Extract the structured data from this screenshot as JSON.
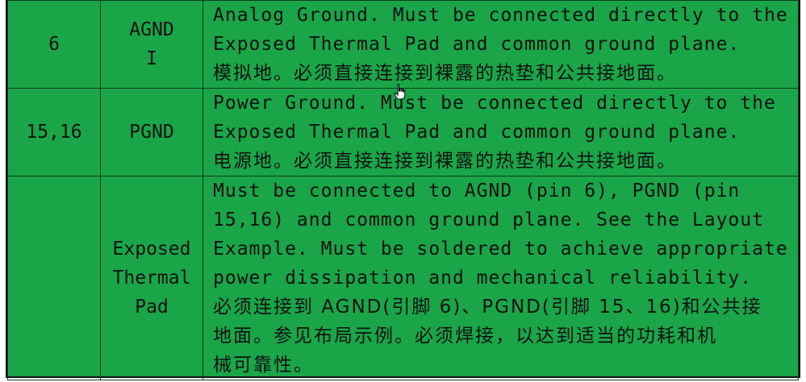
{
  "rows": [
    {
      "pin": "6",
      "name_lines": [
        "AGND",
        "I"
      ],
      "desc_lines": [
        "Analog Ground. Must be connected directly to the",
        "Exposed Thermal Pad and common ground plane.",
        "模拟地。必须直接连接到裸露的热垫和公共接地面。"
      ]
    },
    {
      "pin": "15,16",
      "name_lines": [
        "PGND"
      ],
      "desc_lines": [
        "Power Ground. Must be connected directly to the",
        "Exposed Thermal Pad and common ground plane.",
        "电源地。必须直接连接到裸露的热垫和公共接地面。"
      ]
    },
    {
      "pin": "",
      "name_lines": [
        "Exposed",
        "Thermal",
        "Pad"
      ],
      "desc_lines": [
        "Must be connected to AGND (pin 6), PGND (pin",
        "15,16) and common ground plane. See the Layout",
        "Example. Must be soldered to achieve appropriate",
        "power dissipation and mechanical reliability.",
        "必须连接到 AGND(引脚 6)、PGND(引脚 15、16)和公共接",
        "地面。参见布局示例。必须焊接，以达到适当的功耗和机",
        "械可靠性。"
      ]
    }
  ],
  "colors": {
    "cell_background": "#1aa548",
    "border": "#0d3d1c"
  },
  "cursor_icon": "hand-pointer-icon"
}
